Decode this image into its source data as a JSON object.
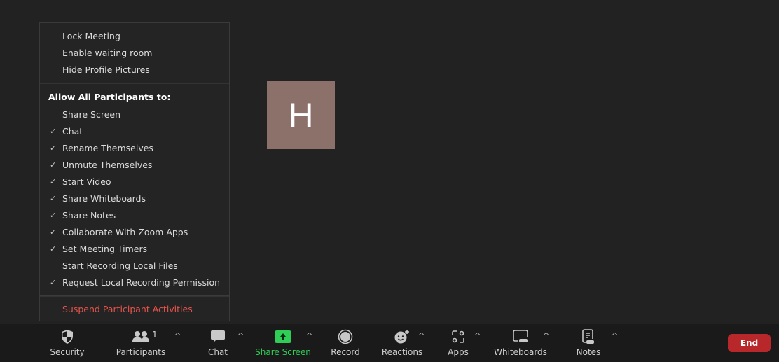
{
  "avatar": {
    "initial": "H",
    "color": "#8c716a"
  },
  "menu": {
    "top_items": [
      {
        "label": "Lock Meeting",
        "checked": false
      },
      {
        "label": "Enable waiting room",
        "checked": false
      },
      {
        "label": "Hide Profile Pictures",
        "checked": false
      }
    ],
    "allow_heading": "Allow All Participants to:",
    "allow_items": [
      {
        "label": "Share Screen",
        "checked": false
      },
      {
        "label": "Chat",
        "checked": true
      },
      {
        "label": "Rename Themselves",
        "checked": true
      },
      {
        "label": "Unmute Themselves",
        "checked": true
      },
      {
        "label": "Start Video",
        "checked": true
      },
      {
        "label": "Share Whiteboards",
        "checked": true
      },
      {
        "label": "Share Notes",
        "checked": true
      },
      {
        "label": "Collaborate With Zoom Apps",
        "checked": true
      },
      {
        "label": "Set Meeting Timers",
        "checked": true
      },
      {
        "label": "Start Recording Local Files",
        "checked": false
      },
      {
        "label": "Request Local Recording Permission",
        "checked": true
      }
    ],
    "suspend_label": "Suspend Participant Activities",
    "check_glyph": "✓"
  },
  "toolbar": {
    "security": "Security",
    "participants": "Participants",
    "participant_count": "1",
    "chat": "Chat",
    "share_screen": "Share Screen",
    "record": "Record",
    "reactions": "Reactions",
    "apps": "Apps",
    "whiteboards": "Whiteboards",
    "notes": "Notes",
    "end": "End",
    "caret": "^",
    "colors": {
      "share_green": "#2fcf57",
      "end_red": "#b8282a"
    }
  }
}
